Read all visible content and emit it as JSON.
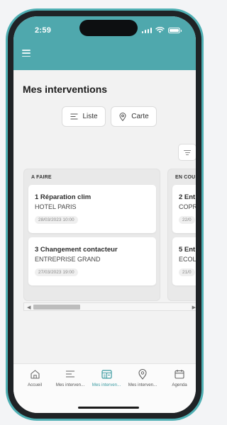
{
  "status_bar": {
    "time": "2:59"
  },
  "page": {
    "title": "Mes interventions"
  },
  "view_toggle": {
    "list_label": "Liste",
    "map_label": "Carte"
  },
  "board": {
    "columns": [
      {
        "title": "A FAIRE",
        "cards": [
          {
            "title": "1 Réparation clim",
            "subtitle": "HOTEL PARIS",
            "date": "28/03/2023 10:00"
          },
          {
            "title": "3 Changement contacteur",
            "subtitle": "ENTREPRISE GRAND",
            "date": "27/03/2023 19:00"
          }
        ]
      },
      {
        "title": "EN COU",
        "cards": [
          {
            "title": "2 Ent",
            "subtitle": "COPR",
            "date": "22/0"
          },
          {
            "title": "5 Ent",
            "subtitle": "ECOL",
            "date": "21/0"
          }
        ]
      }
    ]
  },
  "bottom_nav": {
    "items": [
      {
        "label": "Accueil",
        "icon": "home-icon"
      },
      {
        "label": "Mes interven...",
        "icon": "list-icon"
      },
      {
        "label": "Mes interven...",
        "icon": "board-icon",
        "active": true
      },
      {
        "label": "Mes interven...",
        "icon": "map-pin-icon"
      },
      {
        "label": "Agenda",
        "icon": "calendar-icon"
      }
    ]
  },
  "colors": {
    "accent": "#4fa8ad",
    "active_nav": "#3a9aa0"
  }
}
